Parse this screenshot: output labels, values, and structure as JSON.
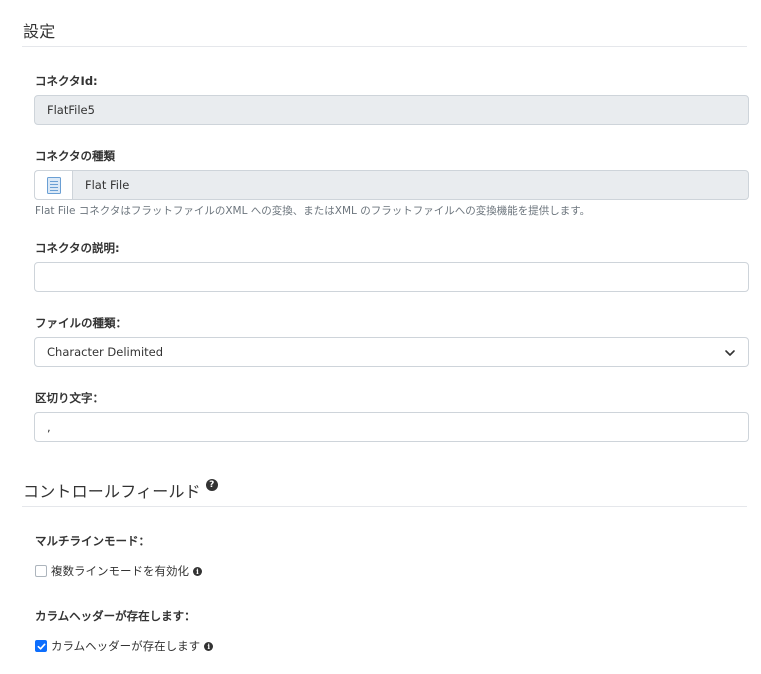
{
  "settings": {
    "title": "設定",
    "connector_id_label": "コネクタId:",
    "connector_id_value": "FlatFile5",
    "connector_type_label": "コネクタの種類",
    "connector_type_value": "Flat File",
    "connector_type_icon": "flat-file-icon",
    "connector_type_help": "Flat File コネクタはフラットファイルのXML への変換、またはXML のフラットファイルへの変換機能を提供します。",
    "description_label": "コネクタの説明:",
    "description_value": "",
    "file_type_label": "ファイルの種類：",
    "file_type_selected": "Character Delimited",
    "delimiter_label": "区切り文字：",
    "delimiter_value": ","
  },
  "control_fields": {
    "title": "コントロールフィールド",
    "multiline_label": "マルチラインモード：",
    "multiline_checkbox_label": "複数ラインモードを有効化",
    "multiline_checked": false,
    "header_label": "カラムヘッダーが存在します：",
    "header_checkbox_label": "カラムヘッダーが存在します",
    "header_checked": true
  },
  "colors": {
    "accent": "#0d6efd",
    "readonly_bg": "#e9ecef",
    "border": "#ced4da"
  }
}
